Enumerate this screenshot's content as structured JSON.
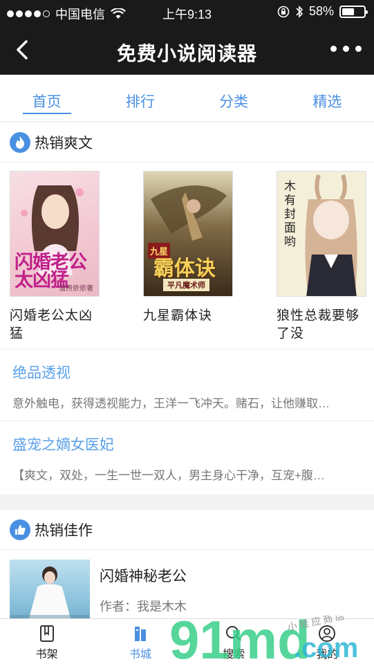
{
  "status": {
    "carrier": "中国电信",
    "time": "上午9:13",
    "battery": "58%",
    "battery_level": 0.58
  },
  "nav": {
    "title": "免费小说阅读器"
  },
  "tabs": [
    {
      "label": "首页",
      "active": true
    },
    {
      "label": "排行"
    },
    {
      "label": "分类"
    },
    {
      "label": "精选"
    }
  ],
  "hot": {
    "title": "热销爽文",
    "books": [
      {
        "title": "闪婚老公太凶猛",
        "cover_text": "闪婚老公太凶猛",
        "cover_author": "温煦依依著"
      },
      {
        "title": "九星霸体诀",
        "cover_text": "霸体诀",
        "cover_badge": "九星",
        "cover_sub": "平凡魔术师"
      },
      {
        "title": "狼性总裁要够了没",
        "cover_text": "木有封面哟"
      }
    ],
    "recs": [
      {
        "title": "绝品透视",
        "desc": "意外触电，获得透视能力，王洋一飞冲天。赌石，让他赚取…"
      },
      {
        "title": "盛宠之嫡女医妃",
        "desc": "【爽文，双处，一生一世一双人，男主身心干净，互宠+腹…"
      }
    ]
  },
  "hot2": {
    "title": "热销佳作",
    "book": {
      "title": "闪婚神秘老公",
      "author": "作者：我是木木"
    }
  },
  "bottom": [
    {
      "label": "书架"
    },
    {
      "label": "书城",
      "active": true
    },
    {
      "label": "搜索"
    },
    {
      "label": "我的"
    }
  ],
  "watermark": {
    "big": "91md",
    "dot": ".com",
    "small": "小 桂 应 商 店"
  },
  "colors": {
    "accent": "#4a90e2",
    "bar": "#1a1a1a"
  }
}
